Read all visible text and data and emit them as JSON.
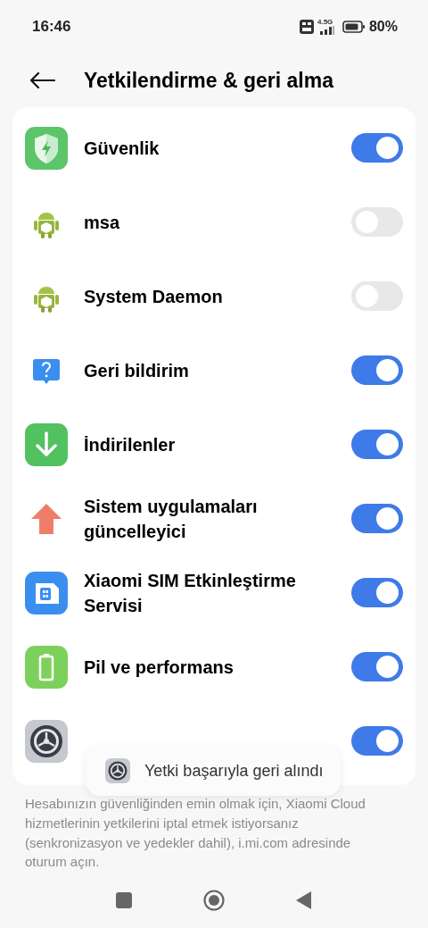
{
  "status_bar": {
    "time": "16:46",
    "network": "4.5G",
    "battery": "80%"
  },
  "header": {
    "title": "Yetkilendirme & geri alma"
  },
  "apps": [
    {
      "kind": "shield",
      "label": "Güvenlik",
      "on": true
    },
    {
      "kind": "android",
      "label": "msa",
      "on": false
    },
    {
      "kind": "android",
      "label": "System Daemon",
      "on": false
    },
    {
      "kind": "feedback",
      "label": "Geri bildirim",
      "on": true
    },
    {
      "kind": "download",
      "label": "İndirilenler",
      "on": true
    },
    {
      "kind": "update",
      "label": "Sistem uygulamaları güncelleyici",
      "on": true
    },
    {
      "kind": "sim",
      "label": "Xiaomi SIM Etkinleştirme Servisi",
      "on": true
    },
    {
      "kind": "battery",
      "label": "Pil ve performans",
      "on": true
    },
    {
      "kind": "settings",
      "on": true
    }
  ],
  "toast": {
    "text": "Yetki başarıyla geri alındı"
  },
  "footer": {
    "text": "Hesabınızın güvenliğinden emin olmak için, Xiaomi Cloud hizmetlerinin yetkilerini iptal etmek istiyorsanız (senkronizasyon ve yedekler dahil), i.mi.com adresinde oturum açın."
  }
}
